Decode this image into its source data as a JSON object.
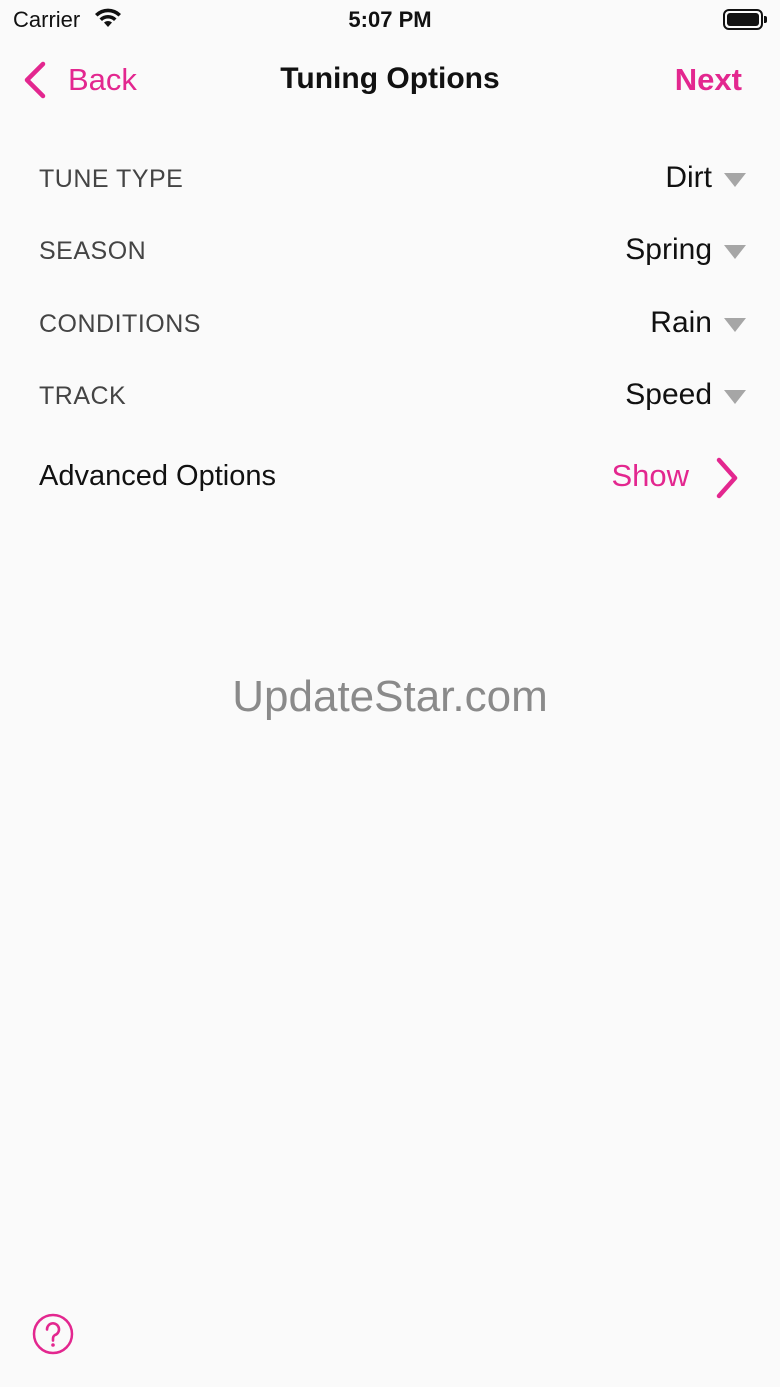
{
  "status_bar": {
    "carrier": "Carrier",
    "time": "5:07 PM",
    "icons": [
      "wifi-icon",
      "battery-icon"
    ]
  },
  "nav": {
    "back_label": "Back",
    "title": "Tuning Options",
    "next_label": "Next"
  },
  "options": [
    {
      "label": "TUNE TYPE",
      "value": "Dirt"
    },
    {
      "label": "SEASON",
      "value": "Spring"
    },
    {
      "label": "CONDITIONS",
      "value": "Rain"
    },
    {
      "label": "TRACK",
      "value": "Speed"
    }
  ],
  "advanced": {
    "label": "Advanced Options",
    "action": "Show"
  },
  "watermark": "UpdateStar.com",
  "colors": {
    "accent": "#e3278f",
    "background": "#fafafa",
    "label_gray": "#444444",
    "dropdown_gray": "#a6a6a6"
  }
}
